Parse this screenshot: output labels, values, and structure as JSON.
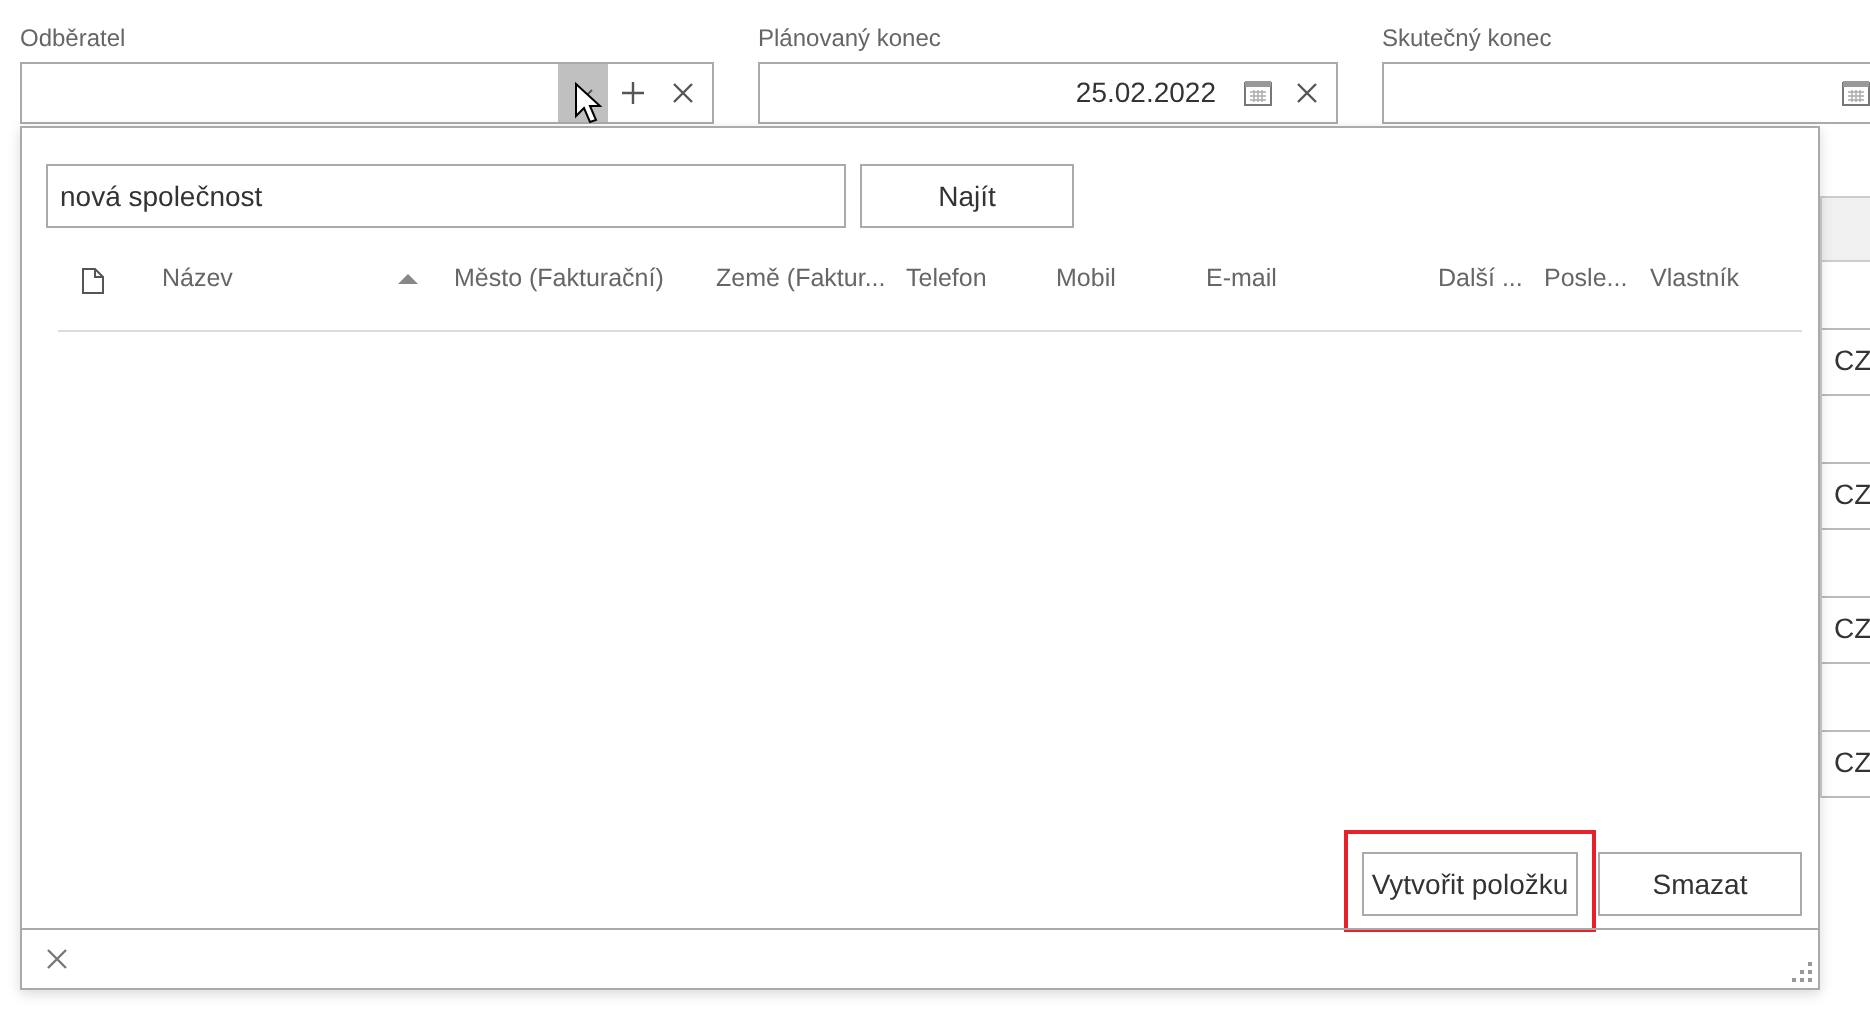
{
  "fields": [
    {
      "label": "Odběratel",
      "kind": "lookup",
      "dropdown_pressed": true
    },
    {
      "label": "Plánovaný konec",
      "kind": "date",
      "value": "25.02.2022"
    },
    {
      "label": "Skutečný konec",
      "kind": "date"
    }
  ],
  "background_grid": {
    "cells": [
      "CZ",
      "CZ",
      "CZ",
      "CZ"
    ]
  },
  "popup": {
    "search": {
      "value": "nová společnost"
    },
    "find_button": "Najít",
    "columns": [
      {
        "label": "Název",
        "sorted": true
      },
      {
        "label": "Město (Fakturační)",
        "sorted": false
      },
      {
        "label": "Země (Faktur...",
        "sorted": false
      },
      {
        "label": "Telefon",
        "sorted": false
      },
      {
        "label": "Mobil",
        "sorted": false
      },
      {
        "label": "E-mail",
        "sorted": false
      },
      {
        "label": "Další ...",
        "sorted": false
      },
      {
        "label": "Posle...",
        "sorted": false
      },
      {
        "label": "Vlastník",
        "sorted": false
      }
    ],
    "buttons": [
      {
        "label": "Vytvořit položku",
        "highlighted": true
      },
      {
        "label": "Smazat",
        "highlighted": false
      }
    ]
  }
}
